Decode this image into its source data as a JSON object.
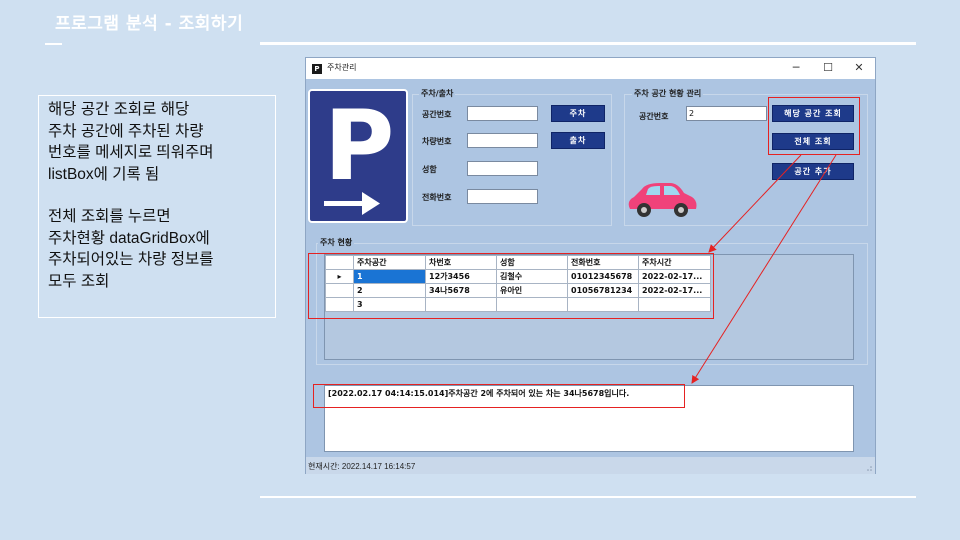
{
  "slide": {
    "title": "프로그램 분석 - 조회하기",
    "description": [
      "해당 공간 조회로 해당\n주차 공간에 주차된 차량\n번호를 메세지로 띄워주며\nlistBox에 기록 됨",
      "전체 조회를 누르면\n주차현황 dataGridBox에\n주차되어있는 차량 정보를\n모두 조회"
    ]
  },
  "window": {
    "title": "주차관리",
    "app_icon": "P",
    "controls": {
      "minimize": "─",
      "maximize": "☐",
      "close": "✕"
    }
  },
  "park_group": {
    "title": "주차/출차",
    "space_label": "공간번호",
    "car_label": "차량번호",
    "name_label": "성함",
    "phone_label": "전화번호",
    "space_value": "",
    "car_value": "",
    "name_value": "",
    "phone_value": "",
    "park_button": "주차",
    "exit_button": "출차"
  },
  "manage_group": {
    "title": "주차 공간 현황 관리",
    "space_label": "공간번호",
    "space_value": "2",
    "lookup_button": "해당 공간 조회",
    "lookup_all_button": "전체 조회",
    "add_space_button": "공간 추가"
  },
  "status_group": {
    "title": "주차 현황",
    "columns": [
      "주차공간",
      "차번호",
      "성함",
      "전화번호",
      "주차시간"
    ],
    "rows": [
      [
        "1",
        "12가3456",
        "김철수",
        "01012345678",
        "2022-02-17..."
      ],
      [
        "2",
        "34나5678",
        "유아인",
        "01056781234",
        "2022-02-17..."
      ],
      [
        "3",
        "",
        "",
        "",
        ""
      ]
    ]
  },
  "log": {
    "entries": [
      "[2022.02.17 04:14:15.014]주차공간 2에 주차되어 있는 차는 34나5678입니다."
    ]
  },
  "statusbar": {
    "text": "현재시간: 2022.14.17 16:14:57"
  },
  "colors": {
    "accent": "#1e3a8a",
    "highlight": "#e52222",
    "car": "#f0427a"
  },
  "icons": {
    "logo": "parking-sign-icon",
    "car": "car-icon",
    "row_indicator": "▸"
  }
}
